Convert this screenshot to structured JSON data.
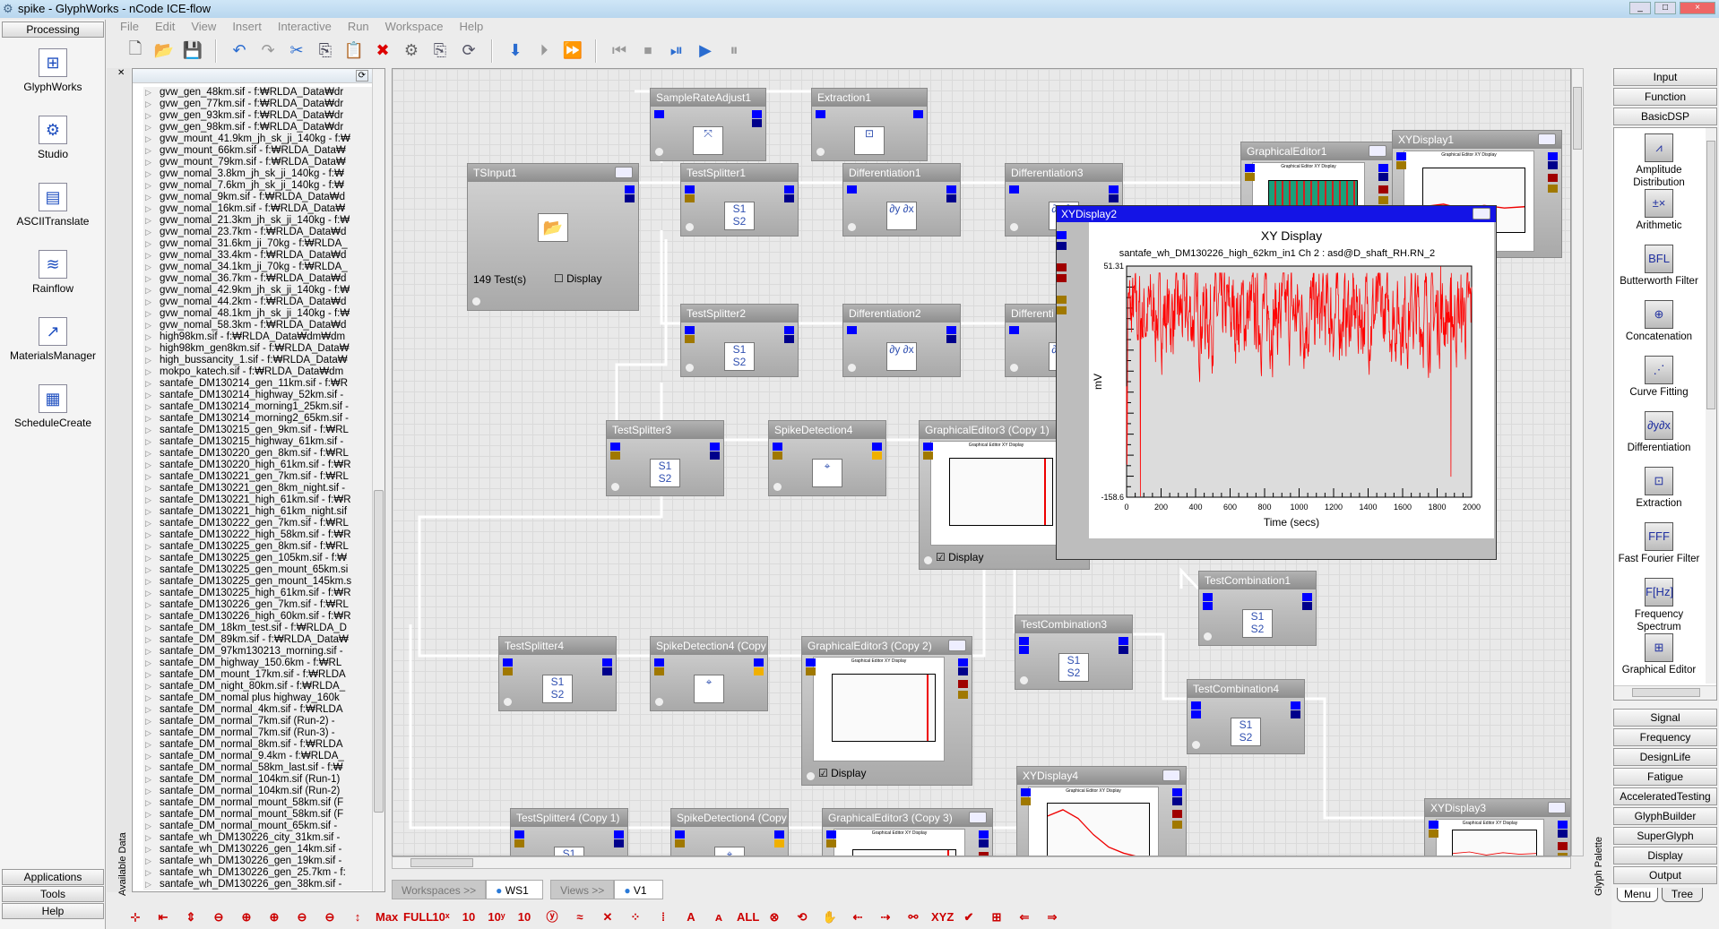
{
  "window": {
    "title": "spike - GlyphWorks - nCode ICE-flow",
    "controls": [
      "_",
      "□",
      "×"
    ]
  },
  "menu": [
    "File",
    "Edit",
    "View",
    "Insert",
    "Interactive",
    "Run",
    "Workspace",
    "Help"
  ],
  "toolbar": [
    {
      "icon": "new-icon",
      "glyph": "🗋",
      "color": "#555"
    },
    {
      "icon": "open-icon",
      "glyph": "📂",
      "color": "#c9a20c"
    },
    {
      "icon": "save-icon",
      "glyph": "💾",
      "color": "#2050b0"
    },
    "sep",
    {
      "icon": "undo-icon",
      "glyph": "↶",
      "color": "#2a6cd0"
    },
    {
      "icon": "redo-icon",
      "glyph": "↷",
      "color": "#999"
    },
    {
      "icon": "cut-icon",
      "glyph": "✂",
      "color": "#2a6cd0"
    },
    {
      "icon": "copy-icon",
      "glyph": "⎘",
      "color": "#445"
    },
    {
      "icon": "paste-icon",
      "glyph": "📋",
      "color": "#999"
    },
    {
      "icon": "stop-icon",
      "glyph": "✖",
      "color": "#d00"
    },
    {
      "icon": "settings-icon",
      "glyph": "⚙",
      "color": "#666"
    },
    {
      "icon": "properties-icon",
      "glyph": "⎘",
      "color": "#556"
    },
    {
      "icon": "refresh-icon",
      "glyph": "⟳",
      "color": "#556"
    },
    "sep",
    {
      "icon": "step-down-icon",
      "glyph": "⬇",
      "color": "#2a6cd0"
    },
    {
      "icon": "step-icon",
      "glyph": "⏵",
      "color": "#999"
    },
    {
      "icon": "fast-step-icon",
      "glyph": "⏩",
      "color": "#999"
    },
    "sep",
    {
      "icon": "rewind-icon",
      "glyph": "⏮",
      "color": "#999"
    },
    {
      "icon": "stop-run-icon",
      "glyph": "⏹",
      "color": "#999"
    },
    {
      "icon": "run-step-icon",
      "glyph": "⏯",
      "color": "#2a6cd0"
    },
    {
      "icon": "play-icon",
      "glyph": "▶",
      "color": "#2a6cd0"
    },
    {
      "icon": "pause-icon",
      "glyph": "⏸",
      "color": "#999"
    }
  ],
  "left_panel": {
    "header": "Processing",
    "apps": [
      {
        "label": "GlyphWorks",
        "glyph": "⊞"
      },
      {
        "label": "Studio",
        "glyph": "⚙"
      },
      {
        "label": "ASCIITranslate",
        "glyph": "▤"
      },
      {
        "label": "Rainflow",
        "glyph": "≋"
      },
      {
        "label": "MaterialsManager",
        "glyph": "↗"
      },
      {
        "label": "ScheduleCreate",
        "glyph": "▦"
      }
    ],
    "footer": [
      "Applications",
      "Tools",
      "Help"
    ]
  },
  "data_panel": {
    "label": "Available Data",
    "files": [
      "gvw_gen_48km.sif - f:₩RLDA_Data₩dr",
      "gvw_gen_77km.sif - f:₩RLDA_Data₩dr",
      "gvw_gen_93km.sif - f:₩RLDA_Data₩dr",
      "gvw_gen_98km.sif - f:₩RLDA_Data₩dr",
      "gvw_mount_41.9km_jh_sk_ji_140kg - f:₩",
      "gvw_mount_66km.sif - f:₩RLDA_Data₩",
      "gvw_mount_79km.sif - f:₩RLDA_Data₩",
      "gvw_nomal_3.8km_jh_sk_ji_140kg - f:₩",
      "gvw_nomal_7.6km_jh_sk_ji_140kg - f:₩",
      "gvw_nomal_9km.sif - f:₩RLDA_Data₩d",
      "gvw_nomal_16km.sif - f:₩RLDA_Data₩",
      "gvw_nomal_21.3km_jh_sk_ji_140kg - f:₩",
      "gvw_nomal_23.7km - f:₩RLDA_Data₩d",
      "gvw_nomal_31.6km_ji_70kg - f:₩RLDA_",
      "gvw_nomal_33.4km - f:₩RLDA_Data₩d",
      "gvw_nomal_34.1km_ji_70kg - f:₩RLDA_",
      "gvw_nomal_36.7km - f:₩RLDA_Data₩d",
      "gvw_nomal_42.9km_jh_sk_ji_140kg - f:₩",
      "gvw_nomal_44.2km - f:₩RLDA_Data₩d",
      "gvw_nomal_48.1km_jh_sk_ji_140kg - f:₩",
      "gvw_nomal_58.3km - f:₩RLDA_Data₩d",
      "high98km.sif - f:₩RLDA_Data₩dm₩dm",
      "high98km_gen8km.sif - f:₩RLDA_Data₩",
      "high_bussancity_1.sif - f:₩RLDA_Data₩",
      "mokpo_katech.sif - f:₩RLDA_Data₩dm",
      "santafe_DM130214_gen_11km.sif - f:₩R",
      "santafe_DM130214_highway_52km.sif -",
      "santafe_DM130214_morning1_25km.sif -",
      "santafe_DM130214_morning2_65km.sif -",
      "santafe_DM130215_gen_9km.sif - f:₩RL",
      "santafe_DM130215_highway_61km.sif -",
      "santafe_DM130220_gen_8km.sif - f:₩RL",
      "santafe_DM130220_high_61km.sif - f:₩R",
      "santafe_DM130221_gen_7km.sif - f:₩RL",
      "santafe_DM130221_gen_8km_night.sif -",
      "santafe_DM130221_high_61km.sif - f:₩R",
      "santafe_DM130221_high_61km_night.sif",
      "santafe_DM130222_gen_7km.sif - f:₩RL",
      "santafe_DM130222_high_58km.sif - f:₩R",
      "santafe_DM130225_gen_8km.sif - f:₩RL",
      "santafe_DM130225_gen_105km.sif - f:₩",
      "santafe_DM130225_gen_mount_65km.si",
      "santafe_DM130225_gen_mount_145km.s",
      "santafe_DM130225_high_61km.sif - f:₩R",
      "santafe_DM130226_gen_7km.sif - f:₩RL",
      "santafe_DM130226_high_60km.sif - f:₩R",
      "santafe_DM_18km_test.sif - f:₩RLDA_D",
      "santafe_DM_89km.sif - f:₩RLDA_Data₩",
      "santafe_DM_97km130213_morning.sif -",
      "santafe_DM_highway_150.6km - f:₩RL",
      "santafe_DM_mount_17km.sif - f:₩RLDA",
      "santafe_DM_night_80km.sif - f:₩RLDA_",
      "santafe_DM_nomal plus highway_160k",
      "santafe_DM_normal_4km.sif - f:₩RLDA",
      "santafe_DM_normal_7km.sif (Run-2) -",
      "santafe_DM_normal_7km.sif (Run-3) -",
      "santafe_DM_normal_8km.sif - f:₩RLDA",
      "santafe_DM_normal_9.4km - f:₩RLDA_",
      "santafe_DM_normal_58km_last.sif - f:₩",
      "santafe_DM_normal_104km.sif (Run-1)",
      "santafe_DM_normal_104km.sif (Run-2)",
      "santafe_DM_normal_mount_58km.sif (F",
      "santafe_DM_normal_mount_58km.sif (F",
      "santafe_DM_normal_mount_65km.sif -",
      "santafe_wh_DM130226_city_31km.sif -",
      "santafe_wh_DM130226_gen_14km.sif -",
      "santafe_wh_DM130226_gen_19km.sif -",
      "santafe_wh_DM130226_gen_25.7km - f:",
      "santafe_wh_DM130226_gen_38km.sif -"
    ]
  },
  "canvas": {
    "nodes": [
      {
        "title": "SampleRateAdjust1",
        "kind": "resample",
        "glyph": "⤧"
      },
      {
        "title": "Extraction1",
        "kind": "extraction",
        "glyph": "⊡"
      },
      {
        "title": "TSInput1",
        "kind": "input",
        "glyph": "📂",
        "tests": "149 Test(s)",
        "display_label": "Display",
        "display_checked": false
      },
      {
        "title": "TestSplitter1",
        "kind": "splitter",
        "glyph": "S1 S2"
      },
      {
        "title": "Differentiation1",
        "kind": "diff",
        "glyph": "∂y ∂x"
      },
      {
        "title": "Differentiation3",
        "kind": "diff",
        "glyph": "∂y ∂x"
      },
      {
        "title": "GraphicalEditor1",
        "kind": "graph",
        "glyph": ""
      },
      {
        "title": "XYDisplay1",
        "kind": "xy",
        "glyph": ""
      },
      {
        "title": "TestSplitter2",
        "kind": "splitter",
        "glyph": "S1 S2"
      },
      {
        "title": "Differentiation2",
        "kind": "diff",
        "glyph": "∂y ∂x"
      },
      {
        "title": "Differenti",
        "kind": "diff",
        "glyph": "∂y ∂x"
      },
      {
        "title": "TestSplitter3",
        "kind": "splitter",
        "glyph": "S1 S2"
      },
      {
        "title": "SpikeDetection4",
        "kind": "spike",
        "glyph": "⌖"
      },
      {
        "title": "GraphicalEditor3 (Copy 1)",
        "kind": "graph",
        "glyph": "",
        "display_label": "Display",
        "display_checked": true
      },
      {
        "title": "TestCombination1",
        "kind": "combine",
        "glyph": "S1 S2"
      },
      {
        "title": "TestSplitter4",
        "kind": "splitter",
        "glyph": "S1 S2"
      },
      {
        "title": "SpikeDetection4 (Copy",
        "kind": "spike",
        "glyph": "⌖"
      },
      {
        "title": "GraphicalEditor3 (Copy 2)",
        "kind": "graph",
        "glyph": "",
        "display_label": "Display",
        "display_checked": true
      },
      {
        "title": "TestCombination3",
        "kind": "combine",
        "glyph": "S1 S2"
      },
      {
        "title": "TestCombination4",
        "kind": "combine",
        "glyph": "S1 S2"
      },
      {
        "title": "XYDisplay4",
        "kind": "xy",
        "glyph": ""
      },
      {
        "title": "XYDisplay3",
        "kind": "xy",
        "glyph": ""
      },
      {
        "title": "TestSplitter4 (Copy 1)",
        "kind": "splitter",
        "glyph": "S1"
      },
      {
        "title": "SpikeDetection4 (Copy",
        "kind": "spike",
        "glyph": "⌖"
      },
      {
        "title": "GraphicalEditor3 (Copy 3)",
        "kind": "graph",
        "glyph": ""
      }
    ],
    "thumb_title": "Graphical Editor XY Display",
    "port_colors": {
      "data": "#0000ff",
      "data_dark": "#00008b",
      "event": "#a00000",
      "meta": "#a07800",
      "meta_light": "#f0b000"
    }
  },
  "xy_popup": {
    "window_title": "XYDisplay2",
    "title": "XY Display",
    "subtitle": "santafe_wh_DM130226_high_62km_in1  Ch 2 : asd@D_shaft_RH.RN_2",
    "chart_data": {
      "type": "line",
      "xlabel": "Time (secs)",
      "ylabel": "mV",
      "xlim": [
        0,
        2000
      ],
      "ylim": [
        -158.6,
        51.31
      ],
      "y_tick_labels": [
        "51.31",
        "-158.6"
      ],
      "x_ticks": [
        "0",
        "200",
        "400",
        "600",
        "800",
        "1000",
        "1200",
        "1400",
        "1600",
        "1800",
        "2000"
      ],
      "series_color": "#ff0000",
      "typical_range": [
        -60,
        45
      ],
      "spikes": [
        {
          "x": 80,
          "y": -158
        },
        {
          "x": 1880,
          "y": -140
        },
        {
          "x": 1820,
          "y": 51
        }
      ]
    }
  },
  "right_panel": {
    "vertical_label": "Glyph Palette",
    "top": [
      "Input",
      "Function",
      "BasicDSP"
    ],
    "items": [
      {
        "label": "Amplitude Distribution",
        "glyph": "⩘"
      },
      {
        "label": "Arithmetic",
        "glyph": "±×"
      },
      {
        "label": "Butterworth Filter",
        "glyph": "BFL"
      },
      {
        "label": "Concatenation",
        "glyph": "⊕"
      },
      {
        "label": "Curve Fitting",
        "glyph": "⋰"
      },
      {
        "label": "Differentiation",
        "glyph": "∂y∂x"
      },
      {
        "label": "Extraction",
        "glyph": "⊡"
      },
      {
        "label": "Fast Fourier Filter",
        "glyph": "FFF"
      },
      {
        "label": "Frequency Spectrum",
        "glyph": "F[Hz]"
      },
      {
        "label": "Graphical Editor",
        "glyph": "⊞"
      }
    ],
    "bottom": [
      "Signal",
      "Frequency",
      "DesignLife",
      "Fatigue",
      "AcceleratedTesting",
      "GlyphBuilder",
      "SuperGlyph",
      "Display",
      "Output"
    ],
    "tabs": [
      "Menu",
      "Tree"
    ]
  },
  "bottom_tabs": {
    "workspaces": "Workspaces >>",
    "ws": "WS1",
    "views": "Views >>",
    "view": "V1"
  },
  "bottom_toolbar": [
    "⊹",
    "⇤",
    "⇕",
    "⊖",
    "⊕",
    "⊕",
    "⊖",
    "⊖",
    "↕",
    "Max",
    "FULL",
    "10ˣ",
    "10",
    "10ʸ",
    "10",
    "ⓨ",
    "≈",
    "✕",
    "⁘",
    "⁞",
    "A",
    "ᴀ",
    "ALL",
    "⊗",
    "⟲",
    "✋",
    "⇠",
    "⇢",
    "⚯",
    "XYZ",
    "✔",
    "⊞",
    "⇐",
    "⇒"
  ]
}
